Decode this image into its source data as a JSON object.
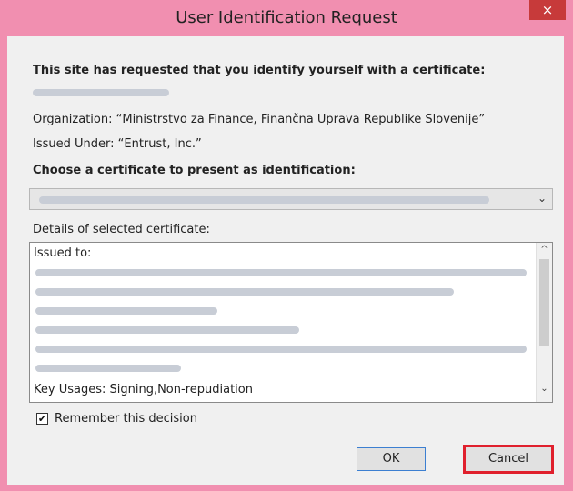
{
  "window": {
    "title": "User Identification Request",
    "close_icon": "×"
  },
  "intro": {
    "heading": "This site has requested that you identify yourself with a certificate:",
    "organization": "Organization: “Ministrstvo za Finance, Finančna Uprava Republike Slovenije”",
    "issued_under": "Issued Under: “Entrust, Inc.”"
  },
  "certificate_select": {
    "label": "Choose a certificate to present as identification:",
    "chevron_icon": "⌄"
  },
  "details": {
    "label": "Details of selected certificate:",
    "issued_to": "Issued to:",
    "key_usages": "Key Usages: Signing,Non-repudiation",
    "scroll_up_icon": "^",
    "scroll_down_icon": "⌄"
  },
  "remember": {
    "label": "Remember this decision",
    "checked": true,
    "check_glyph": "✔"
  },
  "buttons": {
    "ok": "OK",
    "cancel": "Cancel"
  },
  "colors": {
    "titlebar": "#f18fb0",
    "close": "#c73a3a",
    "highlight": "#e0202d"
  }
}
